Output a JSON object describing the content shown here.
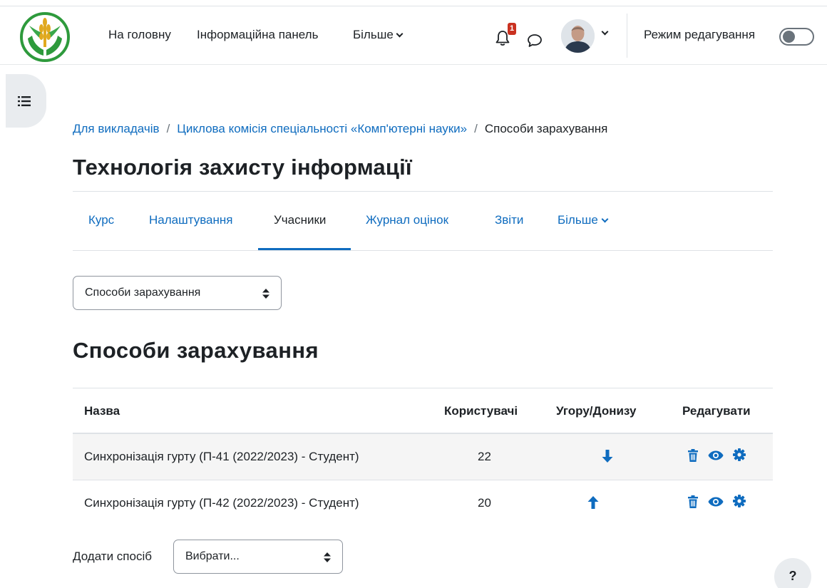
{
  "navbar": {
    "home": "На головну",
    "dashboard": "Інформаційна панель",
    "more": "Більше",
    "notifications_count": "1",
    "edit_mode_label": "Режим редагування",
    "edit_mode_on": false
  },
  "breadcrumb": {
    "items": [
      "Для викладачів",
      "Циклова комісія спеціальності «Комп'ютерні науки»"
    ],
    "separator": "/",
    "current": "Способи зарахування"
  },
  "course": {
    "title": "Технологія захисту інформації"
  },
  "tabs": {
    "items": [
      {
        "label": "Курс",
        "active": false
      },
      {
        "label": "Налаштування",
        "active": false
      },
      {
        "label": "Учасники",
        "active": true
      },
      {
        "label": "Журнал оцінок",
        "active": false
      },
      {
        "label": "Звіти",
        "active": false
      },
      {
        "label": "Більше",
        "active": false
      }
    ]
  },
  "page_select": {
    "selected": "Способи зарахування"
  },
  "section": {
    "title": "Способи зарахування"
  },
  "table": {
    "headers": {
      "name": "Назва",
      "users": "Користувачі",
      "updown": "Угору/Донизу",
      "edit": "Редагувати"
    },
    "rows": [
      {
        "name": "Синхронізація гурту (П-41 (2022/2023) - Студент)",
        "users": "22",
        "move": "down"
      },
      {
        "name": "Синхронізація гурту (П-42 (2022/2023) - Студент)",
        "users": "20",
        "move": "up"
      }
    ]
  },
  "add_method": {
    "label": "Додати спосіб",
    "selected": "Вибрати..."
  },
  "help": {
    "label": "?"
  },
  "colors": {
    "link": "#0f6cbf",
    "text": "#1d2125",
    "badge": "#ca3120"
  }
}
